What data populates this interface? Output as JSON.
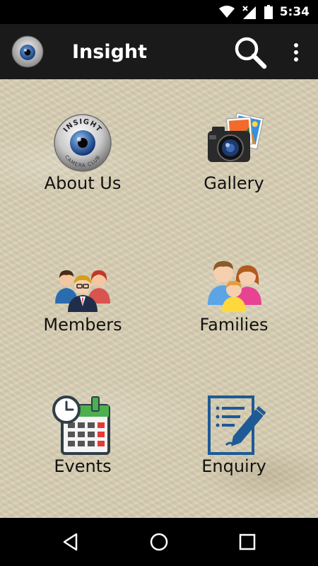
{
  "status_bar": {
    "time": "5:34",
    "icons": [
      "wifi-icon",
      "cellular-no-signal-icon",
      "battery-icon"
    ]
  },
  "app_bar": {
    "title": "Insight",
    "logo_text": "INSIGHT",
    "logo_subtext": "CAMERA CLUB",
    "actions": [
      "search-icon",
      "overflow-menu-icon"
    ]
  },
  "menu": {
    "about": {
      "label": "About Us",
      "icon": "insight-logo-icon"
    },
    "gallery": {
      "label": "Gallery",
      "icon": "camera-photos-icon"
    },
    "members": {
      "label": "Members",
      "icon": "group-people-icon"
    },
    "families": {
      "label": "Families",
      "icon": "family-icon"
    },
    "events": {
      "label": "Events",
      "icon": "calendar-clock-icon"
    },
    "enquiry": {
      "label": "Enquiry",
      "icon": "form-pen-icon"
    }
  },
  "nav_bar": {
    "buttons": [
      "back-icon",
      "home-icon",
      "recents-icon"
    ]
  },
  "colors": {
    "app_bar": "#1a1a1a",
    "background": "#d9cfb4",
    "enquiry_blue": "#1d5a96",
    "calendar_green": "#4caf50"
  }
}
